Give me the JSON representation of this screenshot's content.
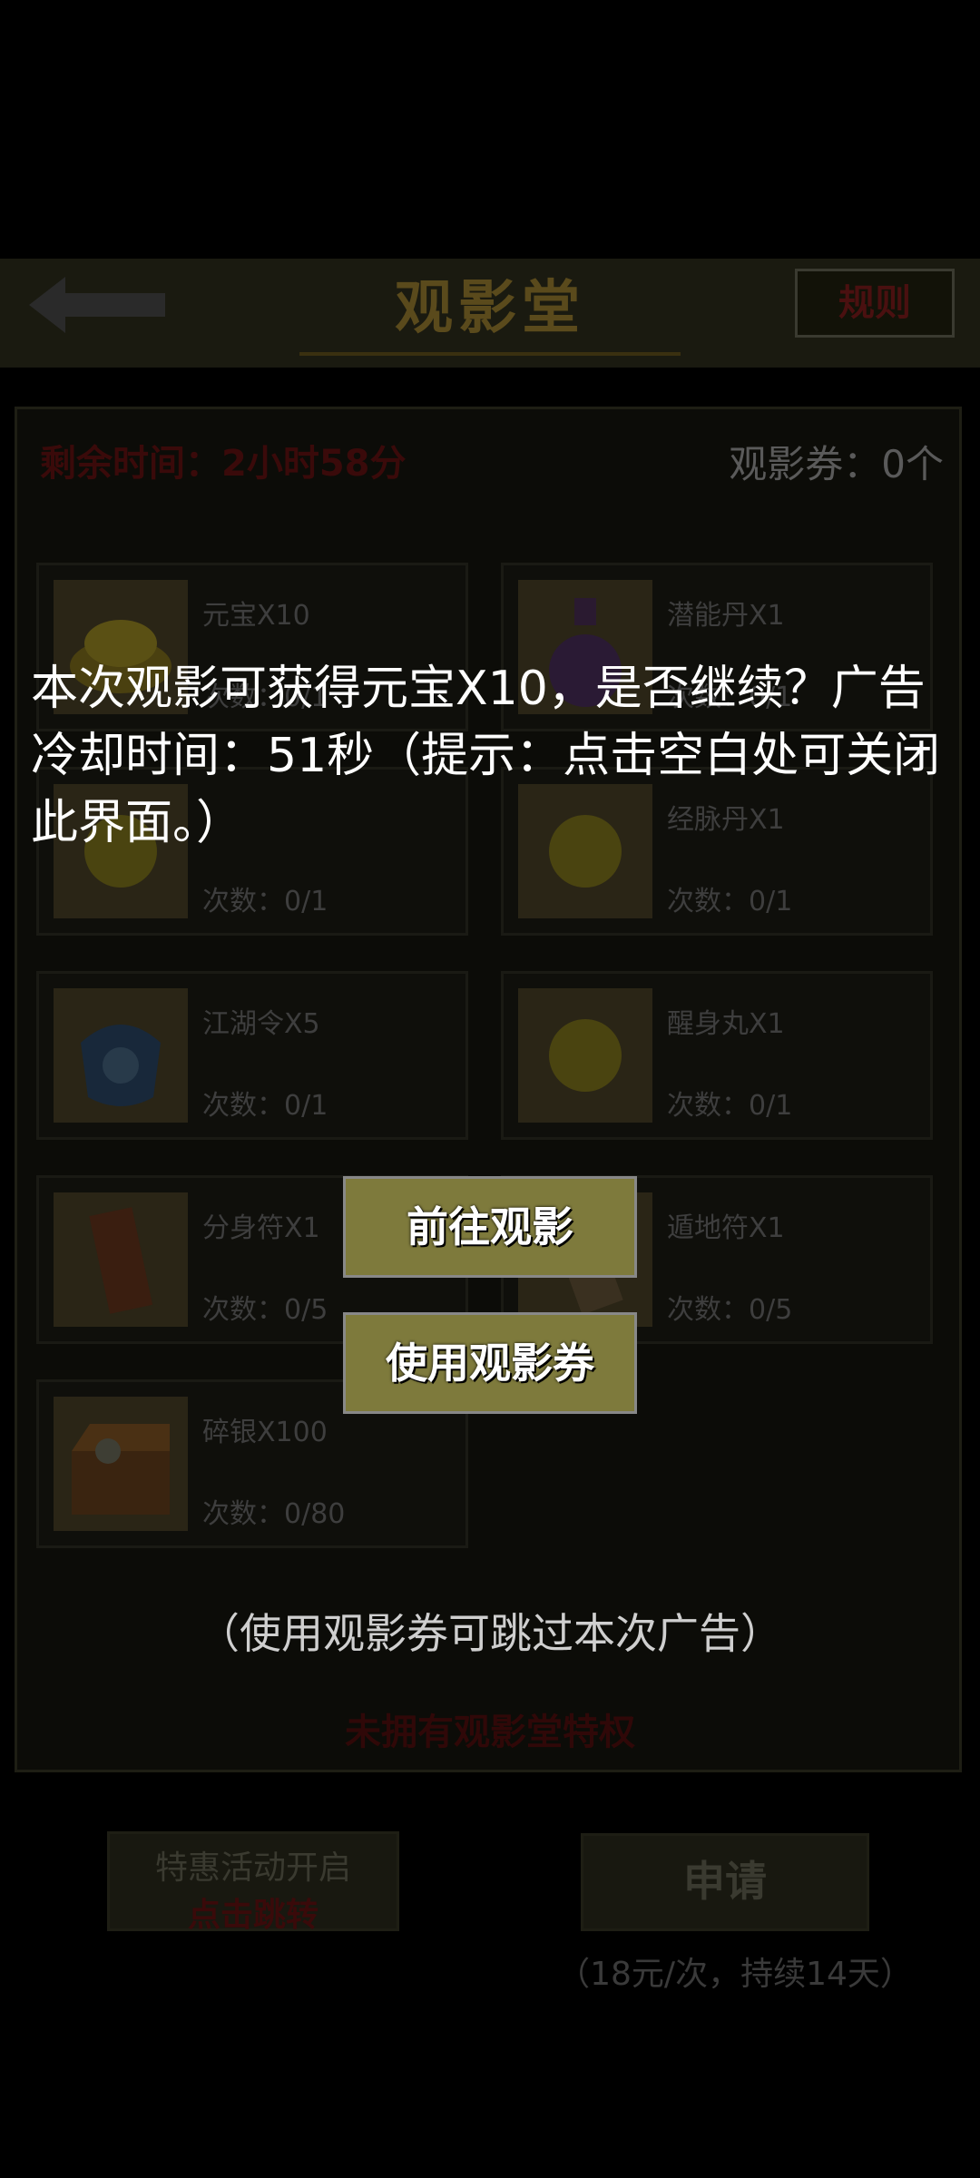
{
  "header": {
    "title": "观影堂",
    "rules_label": "规则"
  },
  "status": {
    "remaining_time": "剩余时间：2小时58分",
    "tickets": "观影券：0个"
  },
  "rewards": [
    {
      "name": "元宝X10",
      "count": "次数：0/1",
      "icon": "gold-ingot-icon"
    },
    {
      "name": "潜能丹X1",
      "count": "次数：0/1",
      "icon": "potion-bottle-icon"
    },
    {
      "name": "",
      "count": "次数：0/1",
      "icon": "yellow-pill-icon"
    },
    {
      "name": "经脉丹X1",
      "count": "次数：0/1",
      "icon": "yellow-pill-icon"
    },
    {
      "name": "江湖令X5",
      "count": "次数：0/1",
      "icon": "token-pouch-icon"
    },
    {
      "name": "醒身丸X1",
      "count": "次数：0/1",
      "icon": "yellow-pill-icon"
    },
    {
      "name": "分身符X1",
      "count": "次数：0/5",
      "icon": "talisman-icon"
    },
    {
      "name": "遁地符X1",
      "count": "次数：0/5",
      "icon": "talisman-icon"
    },
    {
      "name": "碎银X100",
      "count": "次数：0/80",
      "icon": "treasure-chest-icon"
    }
  ],
  "footer": {
    "no_privilege": "未拥有观影堂特权",
    "promo_line1": "特惠活动开启",
    "promo_line2": "点击跳转",
    "apply_label": "申请",
    "price_note": "（18元/次，持续14天）"
  },
  "dialog": {
    "message": "本次观影可获得元宝X10，是否继续？广告冷却时间：51秒（提示：点击空白处可关闭此界面。）",
    "watch_button": "前往观影",
    "ticket_button": "使用观影券",
    "skip_note": "（使用观影券可跳过本次广告）"
  },
  "colors": {
    "button_bg": "#7e7a3c",
    "overlay": "#000000"
  }
}
